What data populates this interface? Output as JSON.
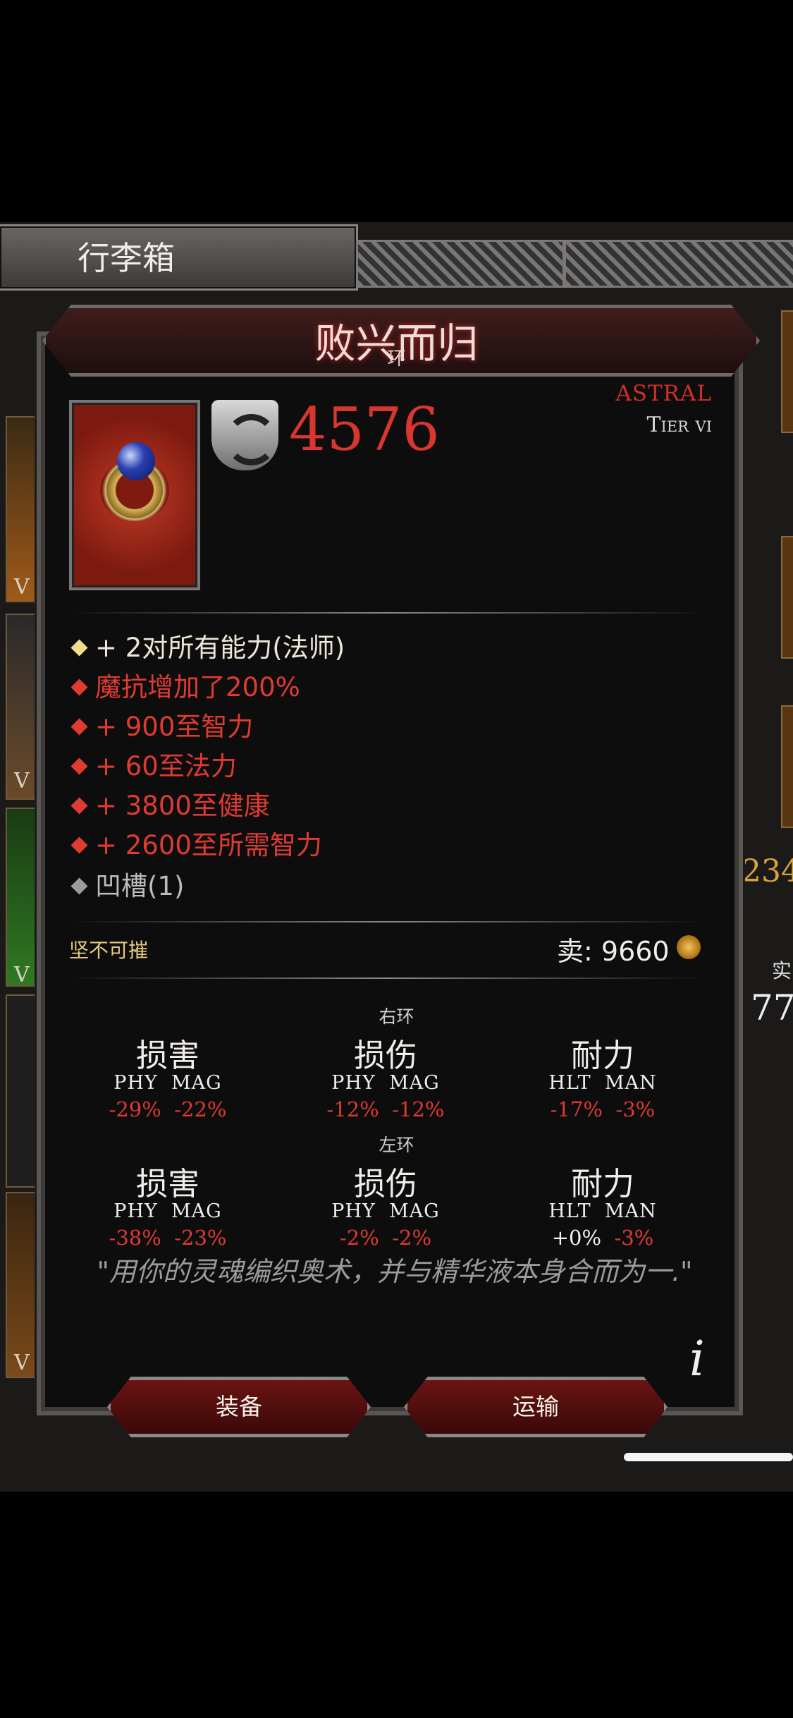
{
  "inventory": {
    "title": "行李箱",
    "side_letter": "V",
    "num_gold": "234",
    "num_white": "77",
    "label_shi": "实"
  },
  "item": {
    "name": "败兴而归",
    "type": "环",
    "power": "4576",
    "rarity": "ASTRAL",
    "tier": "Tier vi",
    "stats": [
      {
        "text": "+ 2对所有能力(法师)",
        "color": "gold"
      },
      {
        "text": "魔抗增加了200%",
        "color": "red"
      },
      {
        "text": "+ 900至智力",
        "color": "red"
      },
      {
        "text": "+ 60至法力",
        "color": "red"
      },
      {
        "text": "+ 3800至健康",
        "color": "red"
      },
      {
        "text": "+ 2600至所需智力",
        "color": "red"
      },
      {
        "text": "凹槽(1)",
        "color": "gray"
      }
    ],
    "durability": "坚不可摧",
    "sell_label": "卖:",
    "sell_value": "9660",
    "icon": "ring-icon",
    "power_icon": "shield-icon",
    "currency_icon": "coin-icon"
  },
  "compare": {
    "right": {
      "label": "右环",
      "cols": [
        {
          "title": "损害",
          "a": "PHY",
          "b": "MAG",
          "va": "-29%",
          "vb": "-22%"
        },
        {
          "title": "损伤",
          "a": "PHY",
          "b": "MAG",
          "va": "-12%",
          "vb": "-12%"
        },
        {
          "title": "耐力",
          "a": "HLT",
          "b": "MAN",
          "va": "-17%",
          "vb": "-3%"
        }
      ]
    },
    "left": {
      "label": "左环",
      "cols": [
        {
          "title": "损害",
          "a": "PHY",
          "b": "MAG",
          "va": "-38%",
          "vb": "-23%"
        },
        {
          "title": "损伤",
          "a": "PHY",
          "b": "MAG",
          "va": "-2%",
          "vb": "-2%"
        },
        {
          "title": "耐力",
          "a": "HLT",
          "b": "MAN",
          "va": "+0%",
          "vb": "-3%"
        }
      ]
    }
  },
  "quote": "\"用你的灵魂编织奥术，并与精华液本身合而为一.\"",
  "buttons": {
    "equip": "装备",
    "transport": "运输"
  },
  "colors": {
    "accent_red": "#d8362e",
    "gold": "#e6c981",
    "panel": "#0d0d0d"
  }
}
